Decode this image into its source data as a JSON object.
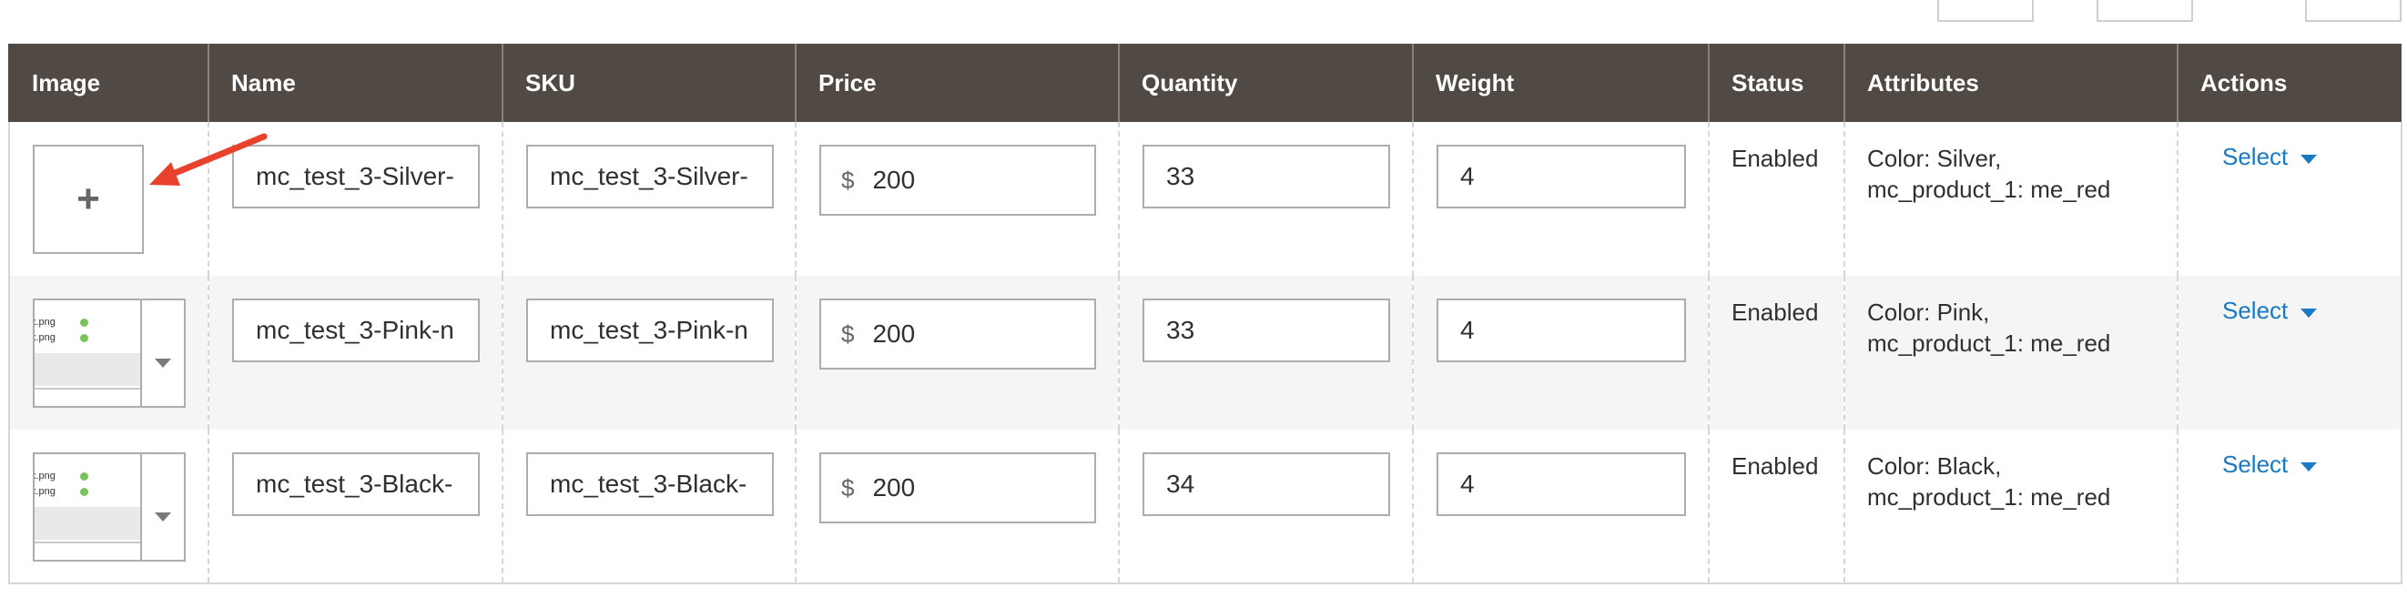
{
  "columns": [
    "Image",
    "Name",
    "SKU",
    "Price",
    "Quantity",
    "Weight",
    "Status",
    "Attributes",
    "Actions"
  ],
  "rows": [
    {
      "image": "empty",
      "name": "mc_test_3-Silver-",
      "sku": "mc_test_3-Silver-",
      "currency": "$",
      "price": "200",
      "quantity": "33",
      "weight": "4",
      "status": "Enabled",
      "attributes": [
        "Color: Silver,",
        "mc_product_1: me_red"
      ],
      "action": "Select"
    },
    {
      "image": "thumbnail",
      "thumb_files": [
        "x.png",
        "x.png"
      ],
      "name": "mc_test_3-Pink-n",
      "sku": "mc_test_3-Pink-n",
      "currency": "$",
      "price": "200",
      "quantity": "33",
      "weight": "4",
      "status": "Enabled",
      "attributes": [
        "Color: Pink,",
        "mc_product_1: me_red"
      ],
      "action": "Select"
    },
    {
      "image": "thumbnail",
      "thumb_files": [
        "x.png",
        "x.png"
      ],
      "name": "mc_test_3-Black-",
      "sku": "mc_test_3-Black-",
      "currency": "$",
      "price": "200",
      "quantity": "34",
      "weight": "4",
      "status": "Enabled",
      "attributes": [
        "Color: Black,",
        "mc_product_1: me_red"
      ],
      "action": "Select"
    }
  ],
  "upload_glyph": "+",
  "colors": {
    "header_bg": "#514943",
    "header_text": "#ffffff",
    "link": "#1979c3",
    "annotation_arrow": "#e8412c",
    "alt_row_bg": "#f5f5f5"
  }
}
